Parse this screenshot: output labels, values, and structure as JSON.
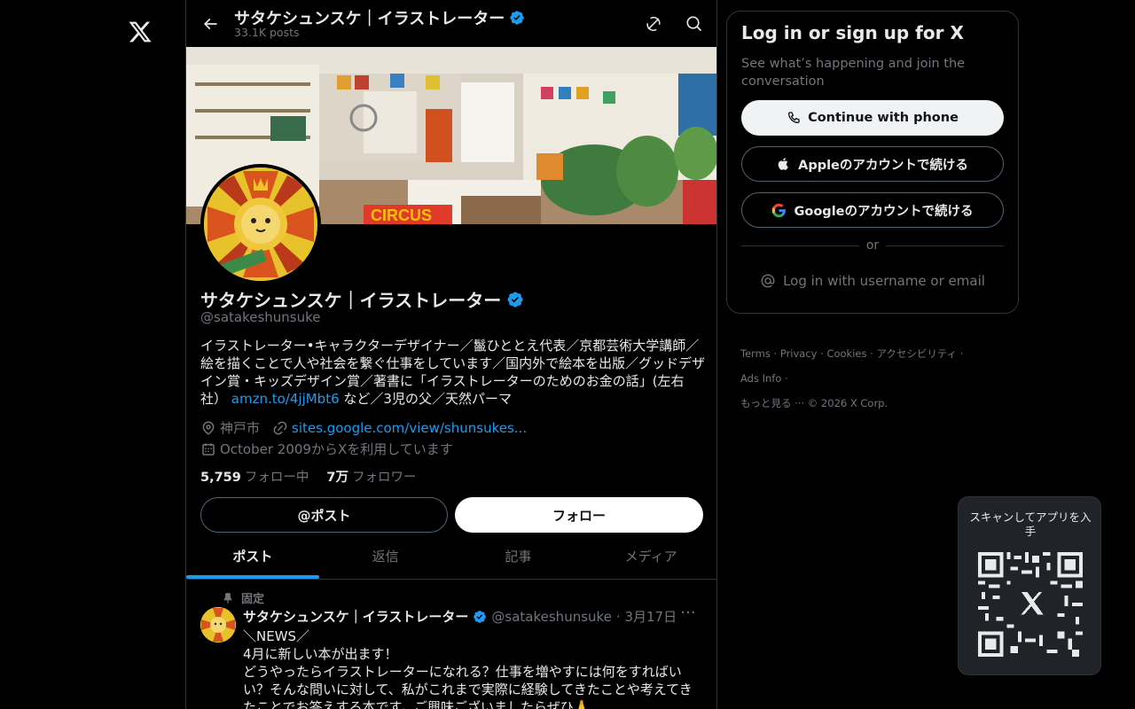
{
  "nav": {
    "logo_icon": "x-logo-icon"
  },
  "topbar": {
    "name": "サタケシュンスケ｜イラストレーター",
    "post_count": "33.1K posts",
    "back_icon": "arrow-left-icon",
    "grok_icon": "grok-icon",
    "search_icon": "search-icon"
  },
  "profile": {
    "name": "サタケシュンスケ｜イラストレーター",
    "handle": "@satakeshunsuke",
    "verified": true,
    "bio_text": "イラストレーター•キャラクターデザイナー／鬣ひととえ代表／京都芸術大学講師／絵を描くことで人や社会を繋ぐ仕事をしています／国内外で絵本を出版／グッドデザイン賞・キッズデザイン賞／著書に「イラストレーターのためのお金の話」(左右社）",
    "bio_link": "amzn.to/4jjMbt6",
    "bio_tail": " など／3児の父／天然パーマ",
    "location": "神戸市",
    "website": "sites.google.com/view/shunsukes...",
    "joined": "October 2009からXを利用しています",
    "following_count": "5,759",
    "following_label": "フォロー中",
    "followers_count": "7万",
    "followers_label": "フォロワー"
  },
  "actions": {
    "post_label": "@ポスト",
    "follow_label": "フォロー"
  },
  "tabs": [
    {
      "label": "ポスト",
      "active": true
    },
    {
      "label": "返信",
      "active": false
    },
    {
      "label": "記事",
      "active": false
    },
    {
      "label": "メディア",
      "active": false
    }
  ],
  "post": {
    "pinned_label": "固定",
    "author": "サタケシュンスケ｜イラストレーター",
    "handle": "@satakeshunsuke",
    "date": "· 3月17日",
    "more": "···",
    "lines": [
      "＼NEWS／",
      "4月に新しい本が出ます！",
      "どうやったらイラストレーターになれる？仕事を増やすには何をすればいい？そんな問いに対して、私がこれまで実際に経験してきたことや考えてきたことでお答えする本です。ご興味ございましたらぜひ🙏"
    ]
  },
  "login": {
    "title": "Log in or sign up for X",
    "subtitle": "See what’s happening and join the conversation",
    "phone_label": "Continue with phone",
    "apple_label": "Appleのアカウントで続ける",
    "google_label": "Googleのアカウントで続ける",
    "or_label": "or",
    "username_label": "Log in with username or email"
  },
  "footer": {
    "terms": "Terms",
    "privacy": "Privacy",
    "cookies": "Cookies",
    "accessibility": "アクセシビリティ",
    "ads": "Ads Info",
    "more": "もっと見る ···",
    "copyright": "© 2026 X Corp."
  },
  "qr": {
    "label": "スキャンしてアプリを入手"
  },
  "colors": {
    "accent": "#1d9bf0",
    "text": "#e7e9ea",
    "muted": "#71767b",
    "border": "#2f3336"
  }
}
